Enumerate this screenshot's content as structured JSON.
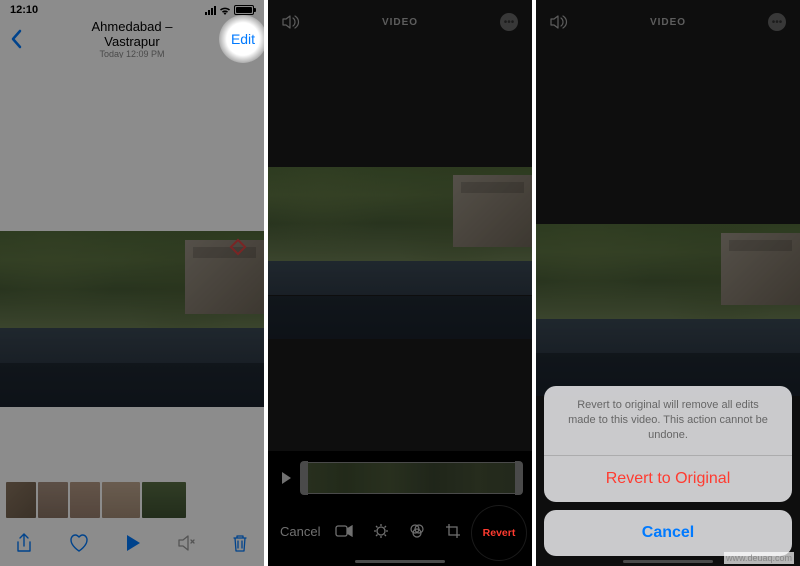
{
  "screen1": {
    "time": "12:10",
    "location": "Ahmedabad – Vastrapur",
    "datetime": "Today 12:09 PM",
    "edit": "Edit"
  },
  "screen2": {
    "top_label": "VIDEO",
    "cancel": "Cancel",
    "revert": "Revert"
  },
  "screen3": {
    "top_label": "VIDEO",
    "sheet_message": "Revert to original will remove all edits made to this video. This action cannot be undone.",
    "sheet_action": "Revert to Original",
    "sheet_cancel": "Cancel"
  },
  "watermark": "www.deuaq.com"
}
